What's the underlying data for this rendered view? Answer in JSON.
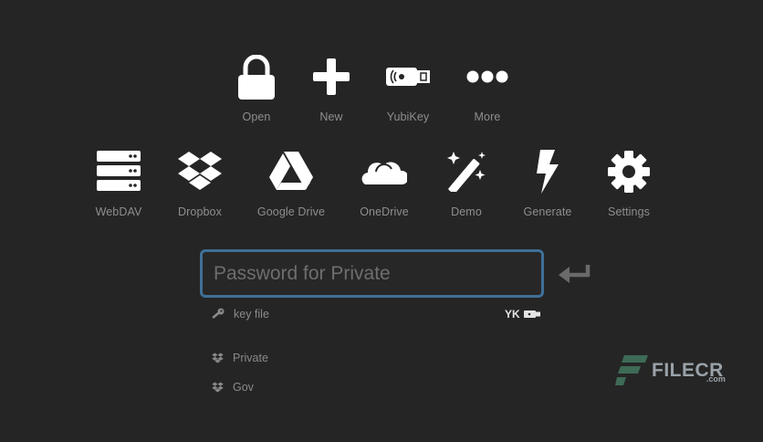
{
  "top_actions": [
    {
      "id": "open",
      "label": "Open",
      "icon": "lock-icon"
    },
    {
      "id": "new",
      "label": "New",
      "icon": "plus-icon"
    },
    {
      "id": "yubikey",
      "label": "YubiKey",
      "icon": "yubikey-icon"
    },
    {
      "id": "more",
      "label": "More",
      "icon": "more-dots-icon"
    }
  ],
  "storage_actions": [
    {
      "id": "webdav",
      "label": "WebDAV",
      "icon": "server-icon"
    },
    {
      "id": "dropbox",
      "label": "Dropbox",
      "icon": "dropbox-icon"
    },
    {
      "id": "google-drive",
      "label": "Google Drive",
      "icon": "google-drive-icon"
    },
    {
      "id": "onedrive",
      "label": "OneDrive",
      "icon": "cloud-icon"
    },
    {
      "id": "demo",
      "label": "Demo",
      "icon": "magic-wand-icon"
    },
    {
      "id": "generate",
      "label": "Generate",
      "icon": "bolt-icon"
    },
    {
      "id": "settings",
      "label": "Settings",
      "icon": "gear-icon"
    }
  ],
  "password": {
    "placeholder": "Password for Private",
    "value": ""
  },
  "key_file": {
    "label": "key file",
    "icon": "key-icon"
  },
  "yk_badge": {
    "label": "YK",
    "icon": "yubikey-small-icon"
  },
  "recent_files": [
    {
      "label": "Private",
      "icon": "dropbox-small-icon"
    },
    {
      "label": "Gov",
      "icon": "dropbox-small-icon"
    }
  ],
  "watermark": {
    "text": "FILECR",
    "suffix": ".com"
  },
  "colors": {
    "background": "#252525",
    "accent_border": "#3f6f96",
    "icon": "#ffffff",
    "label": "#8e8e8e"
  }
}
